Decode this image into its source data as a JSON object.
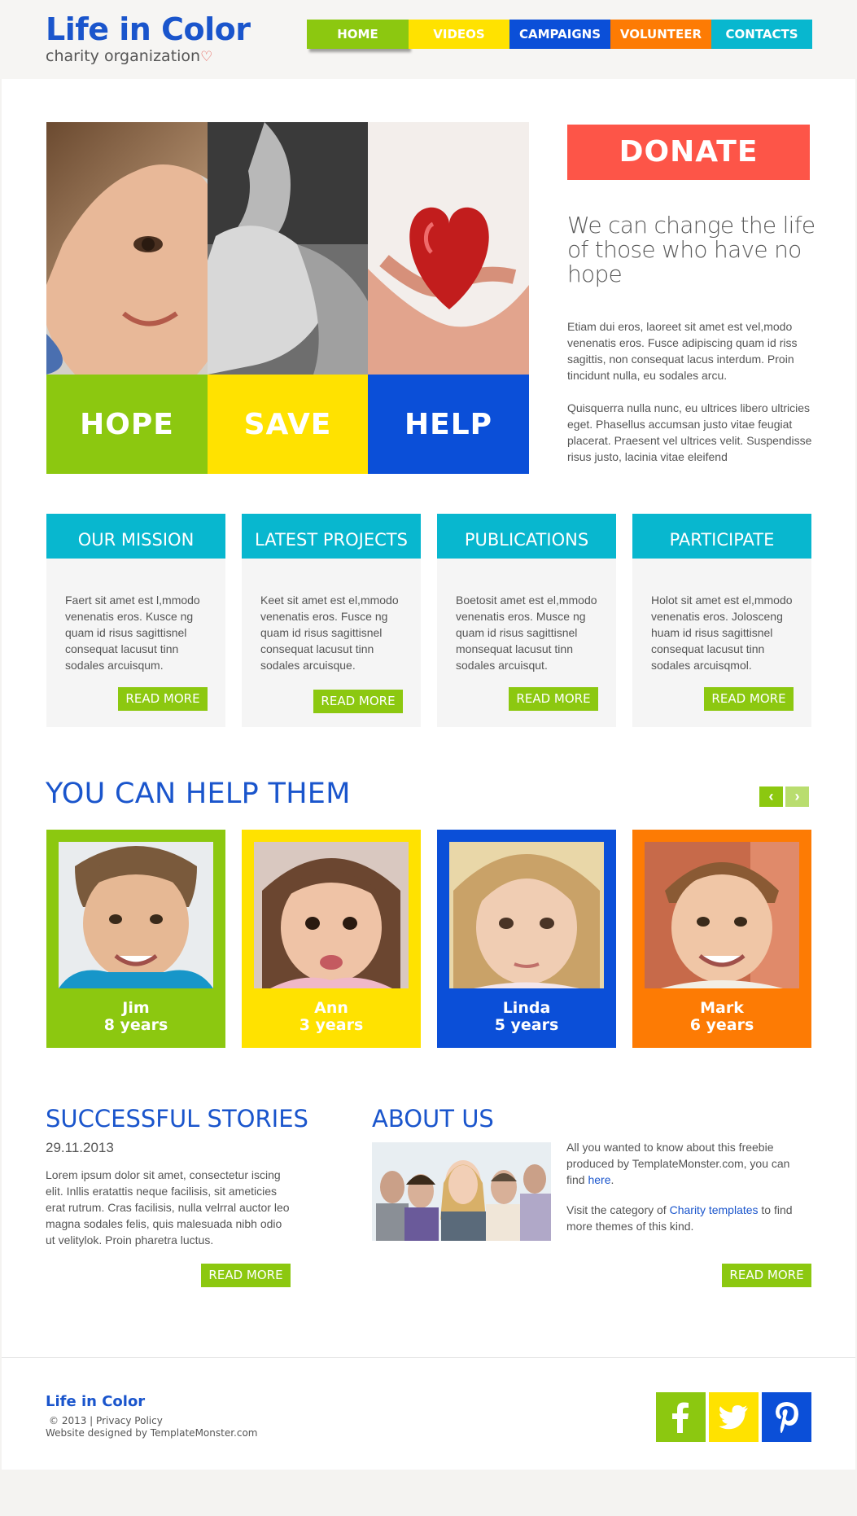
{
  "header": {
    "logo_title": "Life in Color",
    "logo_subtitle": "charity organization"
  },
  "nav": {
    "items": [
      {
        "label": "HOME",
        "color": "#8cc810",
        "text_color": "#ffffff"
      },
      {
        "label": "VIDEOS",
        "color": "#ffe200",
        "text_color": "#ffffff"
      },
      {
        "label": "CAMPAIGNS",
        "color": "#0b4fd8",
        "text_color": "#ffffff"
      },
      {
        "label": "VOLUNTEER",
        "color": "#fd7b04",
        "text_color": "#ffffff"
      },
      {
        "label": "CONTACTS",
        "color": "#08b7cf",
        "text_color": "#ffffff"
      }
    ],
    "active": "HOME"
  },
  "hero": {
    "panels": [
      {
        "label": "HOPE",
        "color": "#8cc810"
      },
      {
        "label": "SAVE",
        "color": "#ffe200"
      },
      {
        "label": "HELP",
        "color": "#0b4fd8"
      }
    ],
    "donate_label": "DONATE",
    "tagline": "We can change the life of those who have no hope",
    "paragraph_1": "Etiam dui eros, laoreet sit amet est vel,modo venenatis eros. Fusce adipiscing quam id riss sagittis, non consequat lacus interdum. Proin tincidunt nulla, eu sodales arcu.",
    "paragraph_2": "Quisquerra nulla nunc, eu ultrices libero ultricies eget. Phasellus accumsan justo vitae feugiat placerat. Praesent vel ultrices velit. Suspendisse risus justo, lacinia vitae eleifend"
  },
  "features": [
    {
      "title": "OUR MISSION",
      "text": "Faert sit amet est l,mmodo venenatis eros. Kusce ng quam id risus sagittisnel consequat lacusut tinn sodales arcuisqum.",
      "button": "READ MORE"
    },
    {
      "title": "LATEST PROJECTS",
      "text": "Keet sit amet est el,mmodo venenatis eros. Fusce ng quam id risus sagittisnel consequat lacusut tinn sodales arcuisque.",
      "button": "READ MORE"
    },
    {
      "title": "PUBLICATIONS",
      "text": "Boetosit amet est el,mmodo venenatis eros. Musce ng quam id risus sagittisnel monsequat lacusut tinn sodales arcuisqut.",
      "button": "READ MORE"
    },
    {
      "title": "PARTICIPATE",
      "text": "Holot sit amet est el,mmodo venenatis eros. Jolosceng huam id risus sagittisnel consequat lacusut tinn sodales arcuisqmol.",
      "button": "READ MORE"
    }
  ],
  "help": {
    "title": "YOU CAN HELP THEM",
    "children": [
      {
        "name": "Jim",
        "age": "8 years",
        "color": "#8cc810"
      },
      {
        "name": "Ann",
        "age": "3 years",
        "color": "#ffe200"
      },
      {
        "name": "Linda",
        "age": "5 years",
        "color": "#0b4fd8"
      },
      {
        "name": "Mark",
        "age": "6 years",
        "color": "#fd7b04"
      }
    ]
  },
  "stories": {
    "title": "SUCCESSFUL STORIES",
    "date": "29.11.2013",
    "text": "Lorem ipsum dolor sit amet, consectetur iscing elit. Inllis eratattis neque facilisis, sit ameticies erat rutrum. Cras facilisis, nulla velrral auctor leo magna sodales felis, quis malesuada nibh odio ut velitylok. Proin pharetra luctus.",
    "button": "READ MORE"
  },
  "about": {
    "title": "ABOUT US",
    "text_1_before": "All you wanted to know about this freebie produced by TemplateMonster.com, you can find ",
    "text_1_link": "here",
    "text_1_after": ".",
    "text_2_before": "Visit the category of ",
    "text_2_link": "Charity templates",
    "text_2_after": " to find more themes of this kind.",
    "button": "READ MORE"
  },
  "footer": {
    "brand": "Life in Color",
    "copyright": "© 2013 |",
    "privacy": "Privacy Policy",
    "designed_by": "Website designed by TemplateMonster.com",
    "social": [
      {
        "name": "facebook",
        "color": "#8cc810"
      },
      {
        "name": "twitter",
        "color": "#ffe200"
      },
      {
        "name": "pinterest",
        "color": "#0b4fd8"
      }
    ]
  }
}
